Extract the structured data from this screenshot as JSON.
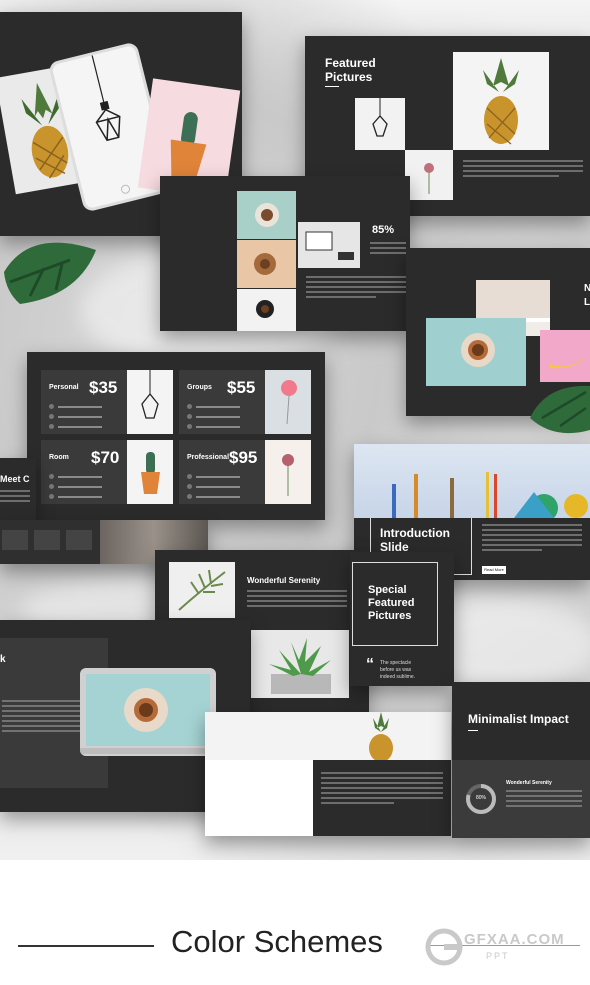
{
  "slides": {
    "featured": {
      "title_line1": "Featured",
      "title_line2": "Pictures"
    },
    "stats": {
      "percent": "85%"
    },
    "pricing": {
      "cards": [
        {
          "name": "Personal",
          "price": "$35"
        },
        {
          "name": "Groups",
          "price": "$55"
        },
        {
          "name": "Room",
          "price": "$70"
        },
        {
          "name": "Professional",
          "price": "$95"
        }
      ]
    },
    "meet": {
      "title": "Meet C"
    },
    "intro": {
      "title_line1": "Introduction",
      "title_line2": "Slide",
      "button": "Read More"
    },
    "serenity": {
      "title": "Wonderful Serenity"
    },
    "special": {
      "line1": "Special",
      "line2": "Featured",
      "line3": "Pictures"
    },
    "quote": {
      "mark": "“",
      "line1": "The spectacle",
      "line2": "before us was",
      "line3": "indeed sublime."
    },
    "minimalist": {
      "title": "Minimalist Impact",
      "donut_value": "80%",
      "sub_title": "Wonderful Serenity"
    },
    "partial_k": {
      "letter": "k"
    },
    "partial_n": {
      "line1": "N",
      "line2": "L"
    }
  },
  "footer": {
    "heading": "Color Schemes",
    "watermark_main": "GFXAA.COM",
    "watermark_sub": "PPT"
  },
  "colors": {
    "slide_bg": "#2b2b2b",
    "card_bg": "#3a3a3a",
    "accent_pink": "#f2b8c0",
    "plant_green": "#3f7a3a"
  }
}
